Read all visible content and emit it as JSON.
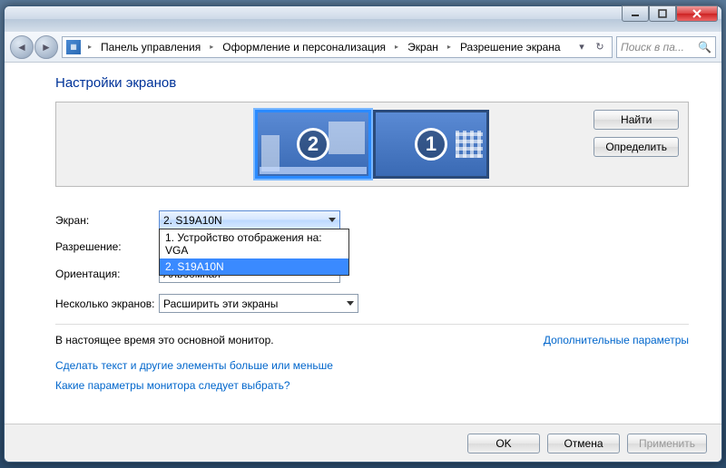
{
  "titlebar": {
    "title_blur": ""
  },
  "breadcrumbs": {
    "items": [
      "Панель управления",
      "Оформление и персонализация",
      "Экран",
      "Разрешение экрана"
    ]
  },
  "search": {
    "placeholder": "Поиск в па..."
  },
  "page_title": "Настройки экранов",
  "monitor_panel": {
    "monitors": [
      {
        "num": "2",
        "selected": true
      },
      {
        "num": "1",
        "selected": false
      }
    ],
    "find_btn": "Найти",
    "identify_btn": "Определить"
  },
  "form": {
    "screen_label": "Экран:",
    "screen_value": "2. S19A10N",
    "screen_options": [
      "1. Устройство отображения на: VGA",
      "2. S19A10N"
    ],
    "screen_selected_index": 1,
    "resolution_label": "Разрешение:",
    "orientation_label": "Ориентация:",
    "orientation_value": "Альбомная",
    "multiple_label": "Несколько экранов:",
    "multiple_value": "Расширить эти экраны"
  },
  "status": {
    "main_text": "В настоящее время это основной монитор.",
    "advanced_link": "Дополнительные параметры"
  },
  "links": {
    "text_size": "Сделать текст и другие элементы больше или меньше",
    "monitor_help": "Какие параметры монитора следует выбрать?"
  },
  "footer": {
    "ok": "OK",
    "cancel": "Отмена",
    "apply": "Применить"
  }
}
